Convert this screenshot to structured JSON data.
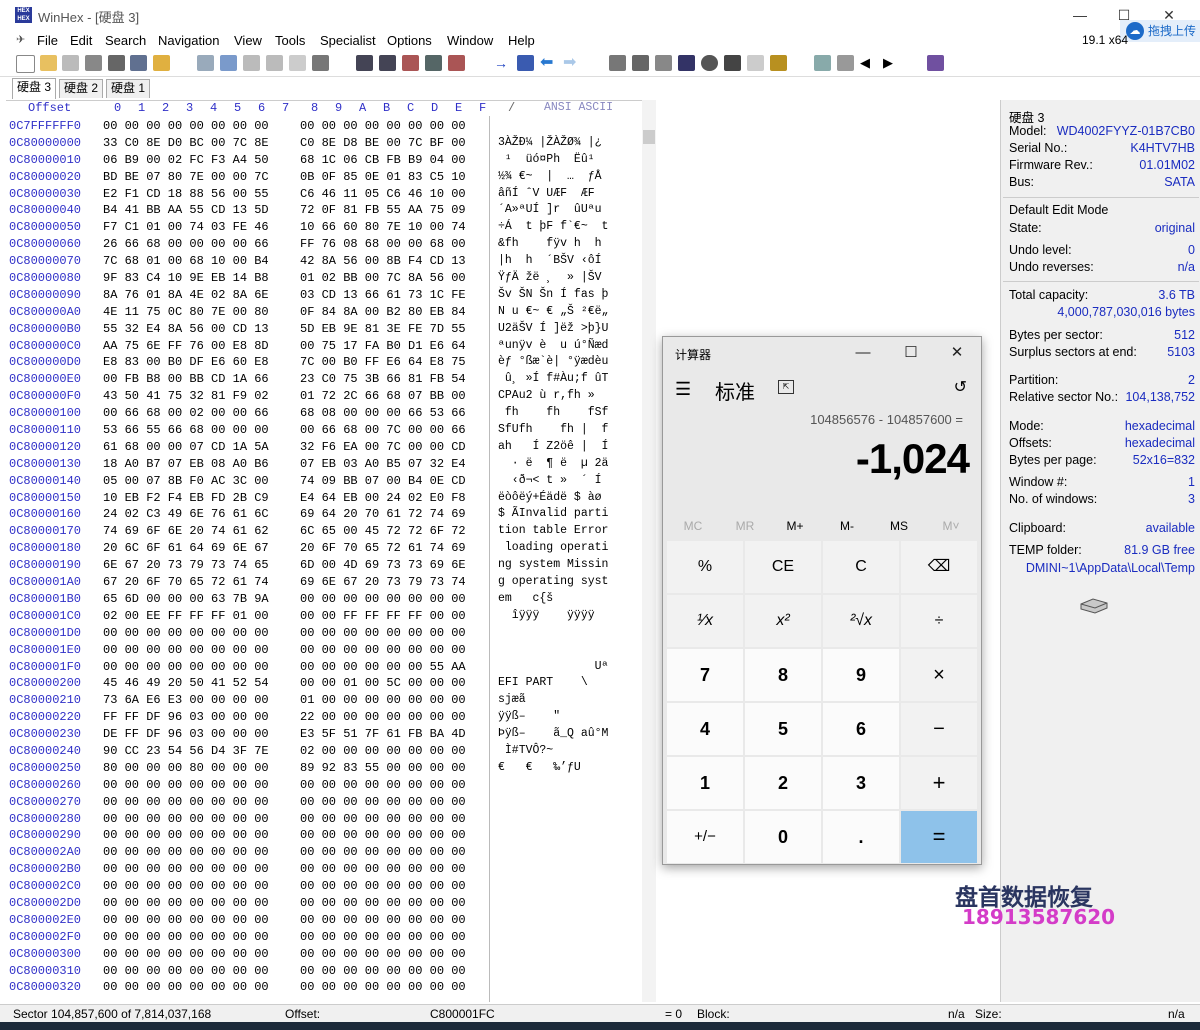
{
  "window": {
    "title": "WinHex - [硬盘 3]",
    "min": "—",
    "max": "☐",
    "close": "✕",
    "cloud_label": "拖拽上传"
  },
  "menu": [
    "File",
    "Edit",
    "Search",
    "Navigation",
    "View",
    "Tools",
    "Specialist",
    "Options",
    "Window",
    "Help"
  ],
  "zoom": "19.1 x64",
  "tabs": [
    "硬盘 3",
    "硬盘 2",
    "硬盘 1"
  ],
  "hex": {
    "header_offset": "Offset",
    "header_cols": [
      "0",
      "1",
      "2",
      "3",
      "4",
      "5",
      "6",
      "7",
      "8",
      "9",
      "A",
      "B",
      "C",
      "D",
      "E",
      "F"
    ],
    "header_slash": "/",
    "header_charset": "ANSI ASCII",
    "rows": [
      {
        "off": "0C7FFFFFF0",
        "h1": "00 00 00 00 00 00 00 00",
        "h2": "00 00 00 00 00 00 00 00",
        "as": ""
      },
      {
        "off": "0C80000000",
        "h1": "33 C0 8E D0 BC 00 7C 8E",
        "h2": "C0 8E D8 BE 00 7C BF 00",
        "as": "3ÀŽÐ¼ |ŽÀŽØ¾ |¿"
      },
      {
        "off": "0C80000010",
        "h1": "06 B9 00 02 FC F3 A4 50",
        "h2": "68 1C 06 CB FB B9 04 00",
        "as": " ¹  üó¤Ph  Ëû¹"
      },
      {
        "off": "0C80000020",
        "h1": "BD BE 07 80 7E 00 00 7C",
        "h2": "0B 0F 85 0E 01 83 C5 10",
        "as": "½¾ €~  |  …  ƒÅ"
      },
      {
        "off": "0C80000030",
        "h1": "E2 F1 CD 18 88 56 00 55",
        "h2": "C6 46 11 05 C6 46 10 00",
        "as": "âñÍ ˆV UÆF  ÆF"
      },
      {
        "off": "0C80000040",
        "h1": "B4 41 BB AA 55 CD 13 5D",
        "h2": "72 0F 81 FB 55 AA 75 09",
        "as": "´A»ªUÍ ]r  ûUªu"
      },
      {
        "off": "0C80000050",
        "h1": "F7 C1 01 00 74 03 FE 46",
        "h2": "10 66 60 80 7E 10 00 74",
        "as": "÷Á  t þF f`€~  t"
      },
      {
        "off": "0C80000060",
        "h1": "26 66 68 00 00 00 00 66",
        "h2": "FF 76 08 68 00 00 68 00",
        "as": "&fh    fÿv h  h"
      },
      {
        "off": "0C80000070",
        "h1": "7C 68 01 00 68 10 00 B4",
        "h2": "42 8A 56 00 8B F4 CD 13",
        "as": "|h  h  ´BŠV ‹ôÍ"
      },
      {
        "off": "0C80000080",
        "h1": "9F 83 C4 10 9E EB 14 B8",
        "h2": "01 02 BB 00 7C 8A 56 00",
        "as": "ŸƒÄ žë ¸  » |ŠV"
      },
      {
        "off": "0C80000090",
        "h1": "8A 76 01 8A 4E 02 8A 6E",
        "h2": "03 CD 13 66 61 73 1C FE",
        "as": "Šv ŠN Šn Í fas þ"
      },
      {
        "off": "0C800000A0",
        "h1": "4E 11 75 0C 80 7E 00 80",
        "h2": "0F 84 8A 00 B2 80 EB 84",
        "as": "N u €~ € „Š ²€ë„"
      },
      {
        "off": "0C800000B0",
        "h1": "55 32 E4 8A 56 00 CD 13",
        "h2": "5D EB 9E 81 3E FE 7D 55",
        "as": "U2äŠV Í ]ëž >þ}U"
      },
      {
        "off": "0C800000C0",
        "h1": "AA 75 6E FF 76 00 E8 8D",
        "h2": "00 75 17 FA B0 D1 E6 64",
        "as": "ªunÿv è  u ú°Ñæd"
      },
      {
        "off": "0C800000D0",
        "h1": "E8 83 00 B0 DF E6 60 E8",
        "h2": "7C 00 B0 FF E6 64 E8 75",
        "as": "èƒ °ßæ`è| °ÿædèu"
      },
      {
        "off": "0C800000E0",
        "h1": "00 FB B8 00 BB CD 1A 66",
        "h2": "23 C0 75 3B 66 81 FB 54",
        "as": " û¸ »Í f#Àu;f ûT"
      },
      {
        "off": "0C800000F0",
        "h1": "43 50 41 75 32 81 F9 02",
        "h2": "01 72 2C 66 68 07 BB 00",
        "as": "CPAu2 ù r,fh »"
      },
      {
        "off": "0C80000100",
        "h1": "00 66 68 00 02 00 00 66",
        "h2": "68 08 00 00 00 66 53 66",
        "as": " fh    fh    fSf"
      },
      {
        "off": "0C80000110",
        "h1": "53 66 55 66 68 00 00 00",
        "h2": "00 66 68 00 7C 00 00 66",
        "as": "SfUfh    fh |  f"
      },
      {
        "off": "0C80000120",
        "h1": "61 68 00 00 07 CD 1A 5A",
        "h2": "32 F6 EA 00 7C 00 00 CD",
        "as": "ah   Í Z2öê |  Í"
      },
      {
        "off": "0C80000130",
        "h1": "18 A0 B7 07 EB 08 A0 B6",
        "h2": "07 EB 03 A0 B5 07 32 E4",
        "as": "  · ë  ¶ ë  µ 2ä"
      },
      {
        "off": "0C80000140",
        "h1": "05 00 07 8B F0 AC 3C 00",
        "h2": "74 09 BB 07 00 B4 0E CD",
        "as": "  ‹ð¬< t »  ´ Í"
      },
      {
        "off": "0C80000150",
        "h1": "10 EB F2 F4 EB FD 2B C9",
        "h2": "E4 64 EB 00 24 02 E0 F8",
        "as": "ëòôëý+Éädë $ àø"
      },
      {
        "off": "0C80000160",
        "h1": "24 02 C3 49 6E 76 61 6C",
        "h2": "69 64 20 70 61 72 74 69",
        "as": "$ ÃInvalid parti"
      },
      {
        "off": "0C80000170",
        "h1": "74 69 6F 6E 20 74 61 62",
        "h2": "6C 65 00 45 72 72 6F 72",
        "as": "tion table Error"
      },
      {
        "off": "0C80000180",
        "h1": "20 6C 6F 61 64 69 6E 67",
        "h2": "20 6F 70 65 72 61 74 69",
        "as": " loading operati"
      },
      {
        "off": "0C80000190",
        "h1": "6E 67 20 73 79 73 74 65",
        "h2": "6D 00 4D 69 73 73 69 6E",
        "as": "ng system Missin"
      },
      {
        "off": "0C800001A0",
        "h1": "67 20 6F 70 65 72 61 74",
        "h2": "69 6E 67 20 73 79 73 74",
        "as": "g operating syst"
      },
      {
        "off": "0C800001B0",
        "h1": "65 6D 00 00 00 63 7B 9A",
        "h2": "00 00 00 00 00 00 00 00",
        "as": "em   c{š"
      },
      {
        "off": "0C800001C0",
        "h1": "02 00 EE FF FF FF 01 00",
        "h2": "00 00 FF FF FF FF 00 00",
        "as": "  îÿÿÿ    ÿÿÿÿ"
      },
      {
        "off": "0C800001D0",
        "h1": "00 00 00 00 00 00 00 00",
        "h2": "00 00 00 00 00 00 00 00",
        "as": ""
      },
      {
        "off": "0C800001E0",
        "h1": "00 00 00 00 00 00 00 00",
        "h2": "00 00 00 00 00 00 00 00",
        "as": ""
      },
      {
        "off": "0C800001F0",
        "h1": "00 00 00 00 00 00 00 00",
        "h2": "00 00 00 00 00 00 55 AA",
        "as": "              Uª"
      },
      {
        "off": "0C80000200",
        "h1": "45 46 49 20 50 41 52 54",
        "h2": "00 00 01 00 5C 00 00 00",
        "as": "EFI PART    \\"
      },
      {
        "off": "0C80000210",
        "h1": "73 6A E6 E3 00 00 00 00",
        "h2": "01 00 00 00 00 00 00 00",
        "as": "sjæã"
      },
      {
        "off": "0C80000220",
        "h1": "FF FF DF 96 03 00 00 00",
        "h2": "22 00 00 00 00 00 00 00",
        "as": "ÿÿß–    \""
      },
      {
        "off": "0C80000230",
        "h1": "DE FF DF 96 03 00 00 00",
        "h2": "E3 5F 51 7F 61 FB BA 4D",
        "as": "Þÿß–    ã_Q aû°M"
      },
      {
        "off": "0C80000240",
        "h1": "90 CC 23 54 56 D4 3F 7E",
        "h2": "02 00 00 00 00 00 00 00",
        "as": " Ì#TVÔ?~"
      },
      {
        "off": "0C80000250",
        "h1": "80 00 00 00 80 00 00 00",
        "h2": "89 92 83 55 00 00 00 00",
        "as": "€   €   ‰’ƒU"
      },
      {
        "off": "0C80000260",
        "h1": "00 00 00 00 00 00 00 00",
        "h2": "00 00 00 00 00 00 00 00",
        "as": ""
      },
      {
        "off": "0C80000270",
        "h1": "00 00 00 00 00 00 00 00",
        "h2": "00 00 00 00 00 00 00 00",
        "as": ""
      },
      {
        "off": "0C80000280",
        "h1": "00 00 00 00 00 00 00 00",
        "h2": "00 00 00 00 00 00 00 00",
        "as": ""
      },
      {
        "off": "0C80000290",
        "h1": "00 00 00 00 00 00 00 00",
        "h2": "00 00 00 00 00 00 00 00",
        "as": ""
      },
      {
        "off": "0C800002A0",
        "h1": "00 00 00 00 00 00 00 00",
        "h2": "00 00 00 00 00 00 00 00",
        "as": ""
      },
      {
        "off": "0C800002B0",
        "h1": "00 00 00 00 00 00 00 00",
        "h2": "00 00 00 00 00 00 00 00",
        "as": ""
      },
      {
        "off": "0C800002C0",
        "h1": "00 00 00 00 00 00 00 00",
        "h2": "00 00 00 00 00 00 00 00",
        "as": ""
      },
      {
        "off": "0C800002D0",
        "h1": "00 00 00 00 00 00 00 00",
        "h2": "00 00 00 00 00 00 00 00",
        "as": ""
      },
      {
        "off": "0C800002E0",
        "h1": "00 00 00 00 00 00 00 00",
        "h2": "00 00 00 00 00 00 00 00",
        "as": ""
      },
      {
        "off": "0C800002F0",
        "h1": "00 00 00 00 00 00 00 00",
        "h2": "00 00 00 00 00 00 00 00",
        "as": ""
      },
      {
        "off": "0C80000300",
        "h1": "00 00 00 00 00 00 00 00",
        "h2": "00 00 00 00 00 00 00 00",
        "as": ""
      },
      {
        "off": "0C80000310",
        "h1": "00 00 00 00 00 00 00 00",
        "h2": "00 00 00 00 00 00 00 00",
        "as": ""
      },
      {
        "off": "0C80000320",
        "h1": "00 00 00 00 00 00 00 00",
        "h2": "00 00 00 00 00 00 00 00",
        "as": ""
      }
    ]
  },
  "info": {
    "disk": "硬盘 3",
    "model_k": "Model:",
    "model_v": "WD4002FYYZ-01B7CB0",
    "serial_k": "Serial No.:",
    "serial_v": "K4HTV7HB",
    "fw_k": "Firmware Rev.:",
    "fw_v": "01.01M02",
    "bus_k": "Bus:",
    "bus_v": "SATA",
    "default_edit": "Default Edit Mode",
    "state_k": "State:",
    "state_v": "original",
    "undo_k": "Undo level:",
    "undo_v": "0",
    "undorev_k": "Undo reverses:",
    "undorev_v": "n/a",
    "cap_k": "Total capacity:",
    "cap_v": "3.6 TB",
    "cap_bytes": "4,000,787,030,016 bytes",
    "bps_k": "Bytes per sector:",
    "bps_v": "512",
    "surplus_k": "Surplus sectors at end:",
    "surplus_v": "5103",
    "part_k": "Partition:",
    "part_v": "2",
    "rel_k": "Relative sector No.:",
    "rel_v": "104,138,752",
    "mode_k": "Mode:",
    "mode_v": "hexadecimal",
    "offs_k": "Offsets:",
    "offs_v": "hexadecimal",
    "bpp_k": "Bytes per page:",
    "bpp_v": "52x16=832",
    "win_k": "Window #:",
    "win_v": "1",
    "nwin_k": "No. of windows:",
    "nwin_v": "3",
    "clip_k": "Clipboard:",
    "clip_v": "available",
    "temp_k": "TEMP folder:",
    "temp_v": "81.9 GB free",
    "temp_path": "DMINI~1\\AppData\\Local\\Temp"
  },
  "calculator": {
    "title": "计算器",
    "mode": "标准",
    "expression": "104856576 - 104857600 =",
    "result": "-1,024",
    "memory": [
      "MC",
      "MR",
      "M+",
      "M-",
      "MS",
      "M˅"
    ],
    "keys": [
      [
        "%",
        "CE",
        "C",
        "⌫"
      ],
      [
        "¹⁄x",
        "x²",
        "²√x",
        "÷"
      ],
      [
        "7",
        "8",
        "9",
        "×"
      ],
      [
        "4",
        "5",
        "6",
        "−"
      ],
      [
        "1",
        "2",
        "3",
        "+"
      ],
      [
        "+/−",
        "0",
        ".",
        "="
      ]
    ]
  },
  "watermark": {
    "line1": "盘首数据恢复",
    "line2": "18913587620"
  },
  "status": {
    "sector": "Sector 104,857,600 of 7,814,037,168",
    "offset_k": "Offset:",
    "offset_v": "C800001FC",
    "eq": "= 0",
    "block_k": "Block:",
    "block_v": "n/a",
    "size_k": "Size:",
    "size_v": "n/a"
  }
}
